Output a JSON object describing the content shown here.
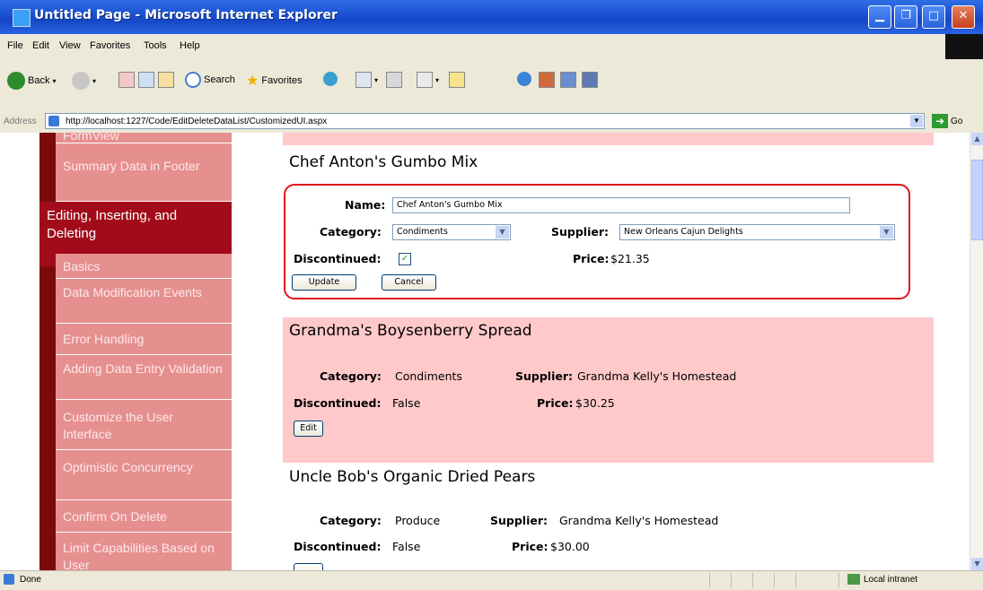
{
  "window": {
    "title": "Untitled Page - Microsoft Internet Explorer"
  },
  "menu": [
    "File",
    "Edit",
    "View",
    "Favorites",
    "Tools",
    "Help"
  ],
  "toolbar": {
    "back": "Back",
    "search": "Search",
    "favorites": "Favorites"
  },
  "address": {
    "label": "Address",
    "url": "http://localhost:1227/Code/EditDeleteDataList/CustomizedUI.aspx",
    "go": "Go"
  },
  "sidebar": {
    "items": [
      {
        "label": "FormView"
      },
      {
        "label": "Summary Data in Footer"
      },
      {
        "label": "Editing, Inserting, and Deleting"
      },
      {
        "label": "Basics"
      },
      {
        "label": "Data Modification Events"
      },
      {
        "label": "Error Handling"
      },
      {
        "label": "Adding Data Entry Validation"
      },
      {
        "label": "Customize the User Interface"
      },
      {
        "label": "Optimistic Concurrency"
      },
      {
        "label": "Confirm On Delete"
      },
      {
        "label": "Limit Capabilities Based on User"
      }
    ]
  },
  "products": {
    "edit": {
      "title": "Chef Anton's Gumbo Mix",
      "name_label": "Name:",
      "name_value": "Chef Anton's Gumbo Mix",
      "category_label": "Category:",
      "category_value": "Condiments",
      "supplier_label": "Supplier:",
      "supplier_value": "New Orleans Cajun Delights",
      "discontinued_label": "Discontinued:",
      "discontinued_checked": true,
      "price_label": "Price:",
      "price_value": "$21.35",
      "update_label": "Update",
      "cancel_label": "Cancel"
    },
    "item2": {
      "title": "Grandma's Boysenberry Spread",
      "category_label": "Category:",
      "category_value": "Condiments",
      "supplier_label": "Supplier:",
      "supplier_value": "Grandma Kelly's Homestead",
      "discontinued_label": "Discontinued:",
      "discontinued_value": "False",
      "price_label": "Price:",
      "price_value": "$30.25",
      "edit_label": "Edit"
    },
    "item3": {
      "title": "Uncle Bob's Organic Dried Pears",
      "category_label": "Category:",
      "category_value": "Produce",
      "supplier_label": "Supplier:",
      "supplier_value": "Grandma Kelly's Homestead",
      "discontinued_label": "Discontinued:",
      "discontinued_value": "False",
      "price_label": "Price:",
      "price_value": "$30.00"
    }
  },
  "status": {
    "left": "Done",
    "zone": "Local intranet"
  },
  "colors": {
    "sidebar_dark": "#7c0a0a",
    "sidebar_item": "#e68f8f",
    "sidebar_selected": "#a10b1a",
    "band": "#ffc9ca",
    "edit_border": "#e0131c"
  }
}
